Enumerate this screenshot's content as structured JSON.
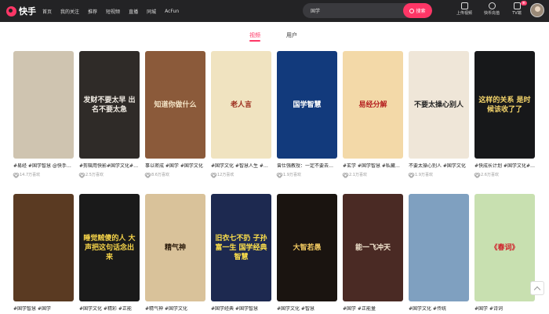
{
  "app": {
    "logo_text": "快手"
  },
  "nav": [
    {
      "label": "首页"
    },
    {
      "label": "我的关注"
    },
    {
      "label": "推荐"
    },
    {
      "label": "短视频"
    },
    {
      "label": "直播"
    },
    {
      "label": "同城"
    },
    {
      "label": "AcFun"
    }
  ],
  "search": {
    "value": "国学",
    "button_label": "搜索"
  },
  "tools": [
    {
      "label": "上传视频",
      "icon": "upload-icon"
    },
    {
      "label": "快币充值",
      "icon": "coin-icon"
    },
    {
      "label": "TV端",
      "icon": "tv-icon",
      "badge": "新"
    }
  ],
  "tabs": [
    {
      "label": "视频",
      "active": true
    },
    {
      "label": "用户",
      "active": false
    }
  ],
  "cards": [
    {
      "title": "#易经 #国学智慧 @快手…",
      "likes": "14.7万喜欢",
      "overlay": "",
      "bg": "#cfc4b0",
      "fg": "#7a3a20"
    },
    {
      "title": "#剪辑用快影#国学文化#…",
      "likes": "2.5万喜欢",
      "overlay": "发财不要太早 出名不要太急",
      "bg": "#2f2b28",
      "fg": "#f1ece4"
    },
    {
      "title": "事以密成 #国学 #国学文化",
      "likes": "8.6万喜欢",
      "overlay": "知道你做什么",
      "bg": "#8b5a3a",
      "fg": "#f2e2c4"
    },
    {
      "title": "#国学文化 #智慧人生 #…",
      "likes": "12万喜欢",
      "overlay": "老人言",
      "bg": "#f0e3c0",
      "fg": "#9a2a1a"
    },
    {
      "title": "曾仕强教授：一定不要去…",
      "likes": "1.9万喜欢",
      "overlay": "国学智慧",
      "bg": "#123a7c",
      "fg": "#ffffff"
    },
    {
      "title": "#玄学 #国学智慧 #私藏…",
      "likes": "2.1万喜欢",
      "overlay": "易经分解",
      "bg": "#f3d9a8",
      "fg": "#b51f1f"
    },
    {
      "title": "不要太操心别人 #国学文化",
      "likes": "1.9万喜欢",
      "overlay": "不要太操心别人",
      "bg": "#efe6d8",
      "fg": "#222222"
    },
    {
      "title": "#快成长计划 #国学文化#…",
      "likes": "2.6万喜欢",
      "overlay": "这样的关系 是时候该收了了",
      "bg": "#17181a",
      "fg": "#f3d36a"
    },
    {
      "title": "#国学智慧 #国学",
      "likes": "",
      "overlay": "",
      "bg": "#5a3a22",
      "fg": "#f3d36a"
    },
    {
      "title": "#国学文化 #精彩 #正能",
      "likes": "",
      "overlay": "睡觉贼傻的人 大声把这句话念出来",
      "bg": "#1a1a1a",
      "fg": "#f6d44a"
    },
    {
      "title": "#精气神 #国学文化",
      "likes": "",
      "overlay": "精气神",
      "bg": "#d9c29a",
      "fg": "#2a1a0a"
    },
    {
      "title": "#国学经典 #国学智慧",
      "likes": "",
      "overlay": "旧衣七不扔 子孙富一生 国学经典智慧",
      "bg": "#1d2950",
      "fg": "#ffe14a"
    },
    {
      "title": "#国学文化 #智慧",
      "likes": "",
      "overlay": "大智若愚",
      "bg": "#1a1410",
      "fg": "#f0c860"
    },
    {
      "title": "#国学 #正能量",
      "likes": "",
      "overlay": "能一飞冲天",
      "bg": "#4a2a24",
      "fg": "#f2e6d0"
    },
    {
      "title": "#国学文化 #传统",
      "likes": "",
      "overlay": "",
      "bg": "#7fa0c0",
      "fg": "#ffffff"
    },
    {
      "title": "#国学 #诗词",
      "likes": "",
      "overlay": "《春词》",
      "bg": "#c8e0b0",
      "fg": "#d0202a"
    }
  ]
}
